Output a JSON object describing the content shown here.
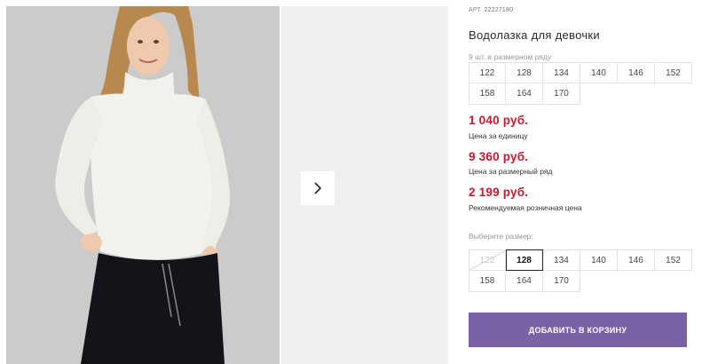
{
  "gallery": {
    "next_icon": "chevron-right-icon",
    "colors": {
      "main_bg": "#c9c9c9",
      "next_bg": "#efefef"
    }
  },
  "product": {
    "art_label": "АРТ.",
    "art_number": "22227180",
    "title": "Водолазка для девочки"
  },
  "size_row": {
    "label": "9 шт. в размерном ряду",
    "sizes": [
      "122",
      "128",
      "134",
      "140",
      "146",
      "152",
      "158",
      "164",
      "170"
    ]
  },
  "prices": [
    {
      "value": "1 040 руб.",
      "label": "Цена за единицу"
    },
    {
      "value": "9 360 руб.",
      "label": "Цена за размерный ряд"
    },
    {
      "value": "2 199 руб.",
      "label": "Рекомендуемая розничная цена"
    }
  ],
  "size_select": {
    "label": "Выберите размер:",
    "sizes": [
      {
        "value": "122",
        "state": "unavailable"
      },
      {
        "value": "128",
        "state": "selected"
      },
      {
        "value": "134",
        "state": "available"
      },
      {
        "value": "140",
        "state": "available"
      },
      {
        "value": "146",
        "state": "available"
      },
      {
        "value": "152",
        "state": "available"
      },
      {
        "value": "158",
        "state": "available"
      },
      {
        "value": "164",
        "state": "available"
      },
      {
        "value": "170",
        "state": "available"
      }
    ]
  },
  "cart": {
    "button_label": "ДОБАВИТЬ В КОРЗИНУ",
    "color": "#7b62a6"
  },
  "colors": {
    "price": "#c8192e"
  }
}
